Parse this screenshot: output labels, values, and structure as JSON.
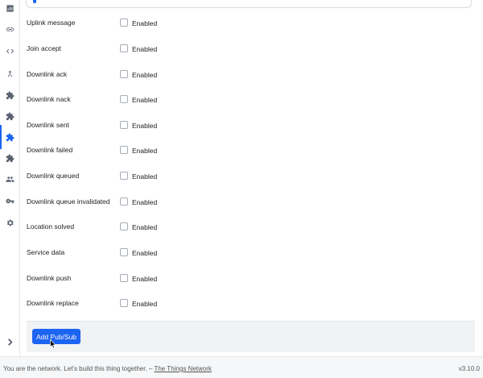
{
  "sidebar": {
    "icons": [
      "chart-icon",
      "link-icon",
      "code-icon",
      "merge-icon",
      "puzzle-icon",
      "puzzle-icon",
      "puzzle-icon",
      "puzzle-icon",
      "users-icon",
      "key-icon",
      "gear-icon"
    ],
    "active_index": 6,
    "collapse_icon": "chevron-right-icon"
  },
  "accent_color": "#1c64f2",
  "message_types": [
    {
      "label": "Uplink message",
      "checkbox_label": "Enabled",
      "checked": false
    },
    {
      "label": "Join accept",
      "checkbox_label": "Enabled",
      "checked": false
    },
    {
      "label": "Downlink ack",
      "checkbox_label": "Enabled",
      "checked": false
    },
    {
      "label": "Downlink nack",
      "checkbox_label": "Enabled",
      "checked": false
    },
    {
      "label": "Downlink sent",
      "checkbox_label": "Enabled",
      "checked": false
    },
    {
      "label": "Downlink failed",
      "checkbox_label": "Enabled",
      "checked": false
    },
    {
      "label": "Downlink queued",
      "checkbox_label": "Enabled",
      "checked": false
    },
    {
      "label": "Downlink queue invalidated",
      "checkbox_label": "Enabled",
      "checked": false
    },
    {
      "label": "Location solved",
      "checkbox_label": "Enabled",
      "checked": false
    },
    {
      "label": "Service data",
      "checkbox_label": "Enabled",
      "checked": false
    },
    {
      "label": "Downlink push",
      "checkbox_label": "Enabled",
      "checked": false
    },
    {
      "label": "Downlink replace",
      "checkbox_label": "Enabled",
      "checked": false
    }
  ],
  "actions": {
    "add_button_label": "Add Pub/Sub"
  },
  "footer": {
    "tagline": "You are the network. Let's build this thing together. – ",
    "link_text": "The Things Network",
    "version": "v3.10.0"
  }
}
